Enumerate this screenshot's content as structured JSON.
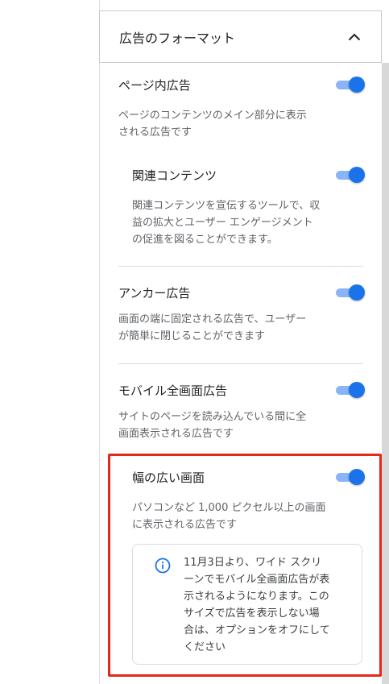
{
  "format_section": {
    "title": "広告のフォーマット"
  },
  "formats": {
    "in_page": {
      "label": "ページ内広告",
      "enabled": true,
      "description_lines": [
        "ページのコンテンツのメイン部分に表示",
        "される広告です"
      ]
    },
    "related_content": {
      "label": "関連コンテンツ",
      "enabled": true,
      "description_lines": [
        "関連コンテンツを宣伝するツールで、収",
        "益の拡大とユーザー エンゲージメント",
        "の促進を図ることができます。"
      ]
    },
    "anchor": {
      "label": "アンカー広告",
      "enabled": true,
      "description_lines": [
        "画面の端に固定される広告で、ユーザー",
        "が簡単に閉じることができます"
      ]
    },
    "vignette": {
      "label": "モバイル全画面広告",
      "enabled": true,
      "description_lines": [
        "サイトのページを読み込んでいる間に全",
        "画面表示される広告です"
      ]
    },
    "wide_screen": {
      "label": "幅の広い画面",
      "enabled": true,
      "description_lines": [
        "パソコンなど 1,000 ピクセル以上の画面",
        "に表示される広告です"
      ],
      "notice_lines": [
        "11月3日より、ワイド スクリ",
        "ーンでモバイル全画面広告が表",
        "示されるようになります。この",
        "サイズで広告を表示しない場",
        "合は、オプションをオフにして",
        "ください"
      ]
    }
  },
  "colors": {
    "toggle_on": "#1a73e8",
    "toggle_track": "#8ab4f8",
    "highlight": "#e8271b"
  },
  "icons": {
    "collapse": "chevron-up-icon",
    "info": "info-icon"
  }
}
